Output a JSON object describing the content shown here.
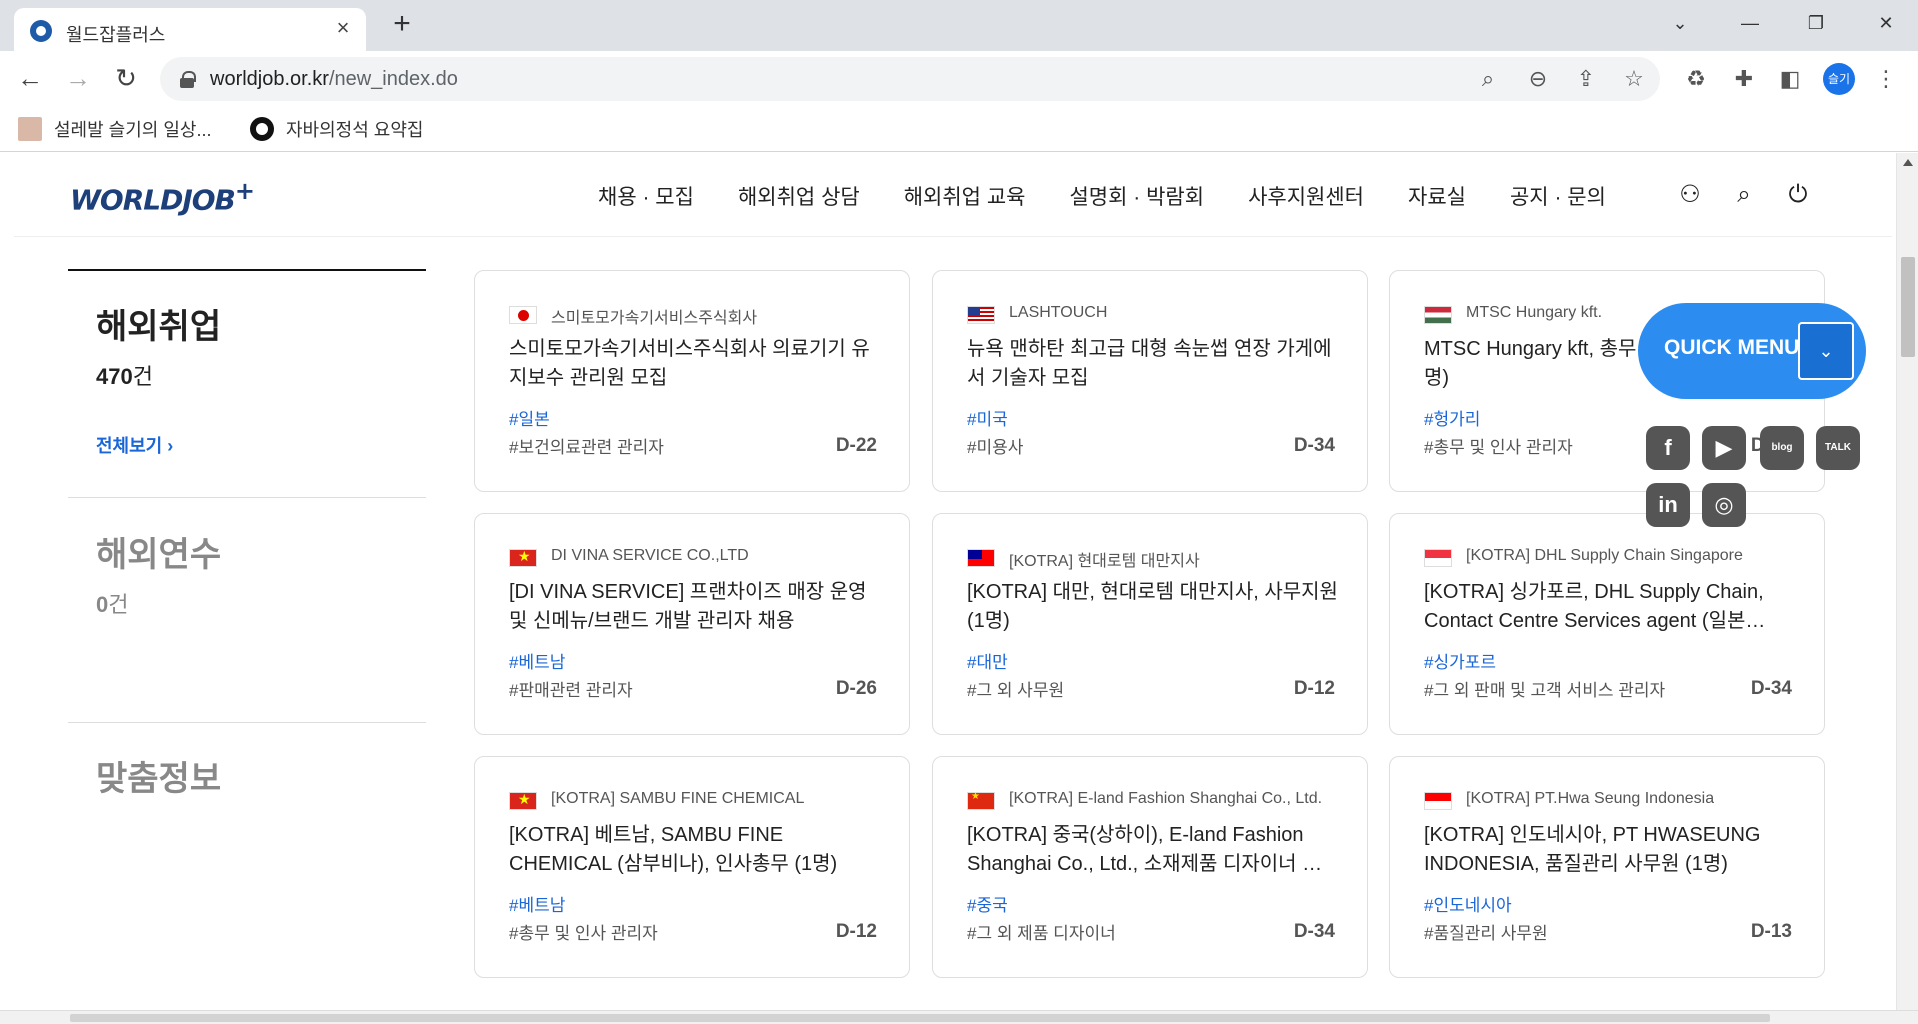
{
  "browser": {
    "tab_title": "월드잡플러스",
    "url_host": "worldjob.or.kr",
    "url_path": "/new_index.do",
    "profile_label": "슬기",
    "bookmarks": [
      "설레발 슬기의 일상...",
      "자바의정석 요약집"
    ]
  },
  "site": {
    "logo": "WORLDJOB",
    "logo_plus": "+",
    "nav": [
      "채용 · 모집",
      "해외취업 상담",
      "해외취업 교육",
      "설명회 · 박람회",
      "사후지원센터",
      "자료실",
      "공지 · 문의"
    ]
  },
  "panel": {
    "sections": [
      {
        "title": "해외취업",
        "count": "470",
        "unit": "건"
      },
      {
        "title": "해외연수",
        "count": "0",
        "unit": "건"
      },
      {
        "title": "맞춤정보"
      }
    ],
    "view_all": "전체보기"
  },
  "cards": [
    {
      "flag": "jp",
      "company": "스미토모가속기서비스주식회사",
      "title": "스미토모가속기서비스주식회사 의료기기 유지보수 관리원 모집",
      "tag": "#일본",
      "job": "#보건의료관련 관리자",
      "dday": "D-22"
    },
    {
      "flag": "us",
      "company": "LASHTOUCH",
      "title": "뉴욕 맨하탄 최고급 대형 속눈썹 연장 가게에서 기술자 모집",
      "tag": "#미국",
      "job": "#미용사",
      "dday": "D-34"
    },
    {
      "flag": "hu",
      "company": "MTSC Hungary kft.",
      "title": "MTSC Hungary kft, 총무 및 인사 관리자(1명)",
      "tag": "#헝가리",
      "job": "#총무 및 인사 관리자",
      "dday": "D-18"
    },
    {
      "flag": "vn",
      "company": "DI VINA SERVICE CO.,LTD",
      "title": "[DI VINA SERVICE] 프랜차이즈 매장 운영 및 신메뉴/브랜드 개발 관리자 채용",
      "tag": "#베트남",
      "job": "#판매관련 관리자",
      "dday": "D-26"
    },
    {
      "flag": "tw",
      "company": "[KOTRA] 현대로템 대만지사",
      "title": "[KOTRA] 대만, 현대로템 대만지사, 사무지원(1명)",
      "tag": "#대만",
      "job": "#그 외 사무원",
      "dday": "D-12"
    },
    {
      "flag": "sg",
      "company": "[KOTRA] DHL Supply Chain Singapore",
      "title": "[KOTRA] 싱가포르, DHL Supply Chain, Contact Centre Services agent (일본…",
      "tag": "#싱가포르",
      "job": "#그 외 판매 및 고객 서비스 관리자",
      "dday": "D-34"
    },
    {
      "flag": "vn",
      "company": "[KOTRA] SAMBU FINE CHEMICAL",
      "title": "[KOTRA] 베트남, SAMBU FINE CHEMICAL (삼부비나), 인사총무 (1명)",
      "tag": "#베트남",
      "job": "#총무 및 인사 관리자",
      "dday": "D-12"
    },
    {
      "flag": "cn",
      "company": "[KOTRA] E-land Fashion Shanghai Co., Ltd.",
      "title": "[KOTRA] 중국(상하이), E-land Fashion Shanghai Co., Ltd., 소재제품 디자이너 …",
      "tag": "#중국",
      "job": "#그 외 제품 디자이너",
      "dday": "D-34"
    },
    {
      "flag": "id",
      "company": "[KOTRA] PT.Hwa Seung Indonesia",
      "title": "[KOTRA] 인도네시아, PT HWASEUNG INDONESIA, 품질관리 사무원 (1명)",
      "tag": "#인도네시아",
      "job": "#품질관리 사무원",
      "dday": "D-13"
    }
  ],
  "quick_menu": {
    "label": "QUICK MENU",
    "social": [
      {
        "name": "facebook",
        "glyph": "f"
      },
      {
        "name": "youtube",
        "glyph": "▶"
      },
      {
        "name": "blog",
        "glyph": "blog"
      },
      {
        "name": "kakaotalk",
        "glyph": "TALK"
      },
      {
        "name": "linkedin",
        "glyph": "in"
      },
      {
        "name": "instagram",
        "glyph": "◎"
      }
    ]
  }
}
